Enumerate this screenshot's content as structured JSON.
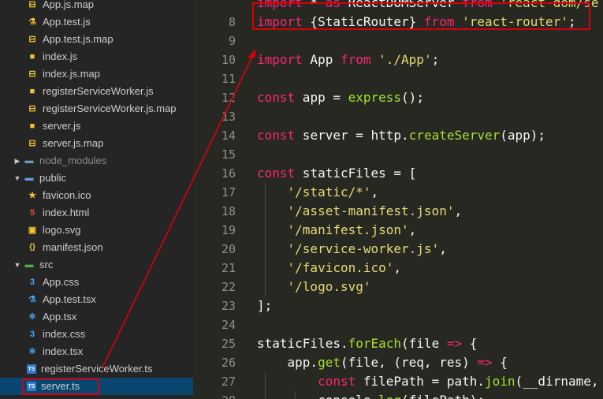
{
  "sidebar": {
    "items": [
      {
        "label": "App.js.map",
        "icon": "file-map-icon",
        "indent": 2,
        "kind": "file",
        "iconColor": "#f1c232",
        "iconGlyph": "⊟"
      },
      {
        "label": "App.test.js",
        "icon": "flask-icon",
        "indent": 2,
        "kind": "file",
        "iconColor": "#f1c232",
        "iconGlyph": "⚗"
      },
      {
        "label": "App.test.js.map",
        "icon": "file-map-icon",
        "indent": 2,
        "kind": "file",
        "iconColor": "#f1c232",
        "iconGlyph": "⊟"
      },
      {
        "label": "index.js",
        "icon": "js-file-icon",
        "indent": 2,
        "kind": "file",
        "iconColor": "#f1c232",
        "iconGlyph": "■"
      },
      {
        "label": "index.js.map",
        "icon": "file-map-icon",
        "indent": 2,
        "kind": "file",
        "iconColor": "#f1c232",
        "iconGlyph": "⊟"
      },
      {
        "label": "registerServiceWorker.js",
        "icon": "js-file-icon",
        "indent": 2,
        "kind": "file",
        "iconColor": "#f1c232",
        "iconGlyph": "■"
      },
      {
        "label": "registerServiceWorker.js.map",
        "icon": "file-map-icon",
        "indent": 2,
        "kind": "file",
        "iconColor": "#f1c232",
        "iconGlyph": "⊟"
      },
      {
        "label": "server.js",
        "icon": "js-file-icon",
        "indent": 2,
        "kind": "file",
        "iconColor": "#f1c232",
        "iconGlyph": "■"
      },
      {
        "label": "server.js.map",
        "icon": "file-map-icon",
        "indent": 2,
        "kind": "file",
        "iconColor": "#f1c232",
        "iconGlyph": "⊟"
      },
      {
        "label": "node_modules",
        "icon": "folder-icon",
        "indent": 1,
        "kind": "folder-collapsed",
        "iconColor": "#6a9fb5",
        "iconGlyph": "▬"
      },
      {
        "label": "public",
        "icon": "folder-open-icon",
        "indent": 1,
        "kind": "folder-open",
        "iconColor": "#5aa0e0",
        "iconGlyph": "▬"
      },
      {
        "label": "favicon.ico",
        "icon": "star-icon",
        "indent": 2,
        "kind": "file",
        "iconColor": "#f1c232",
        "iconGlyph": "★"
      },
      {
        "label": "index.html",
        "icon": "html-file-icon",
        "indent": 2,
        "kind": "file",
        "iconColor": "#e44d26",
        "iconGlyph": "5"
      },
      {
        "label": "logo.svg",
        "icon": "image-file-icon",
        "indent": 2,
        "kind": "file",
        "iconColor": "#f1c232",
        "iconGlyph": "▣"
      },
      {
        "label": "manifest.json",
        "icon": "json-file-icon",
        "indent": 2,
        "kind": "file",
        "iconColor": "#f1c232",
        "iconGlyph": "{}"
      },
      {
        "label": "src",
        "icon": "folder-open-icon",
        "indent": 1,
        "kind": "folder-open",
        "iconColor": "#4caf50",
        "iconGlyph": "▬"
      },
      {
        "label": "App.css",
        "icon": "css-file-icon",
        "indent": 2,
        "kind": "file",
        "iconColor": "#42a5f5",
        "iconGlyph": "3"
      },
      {
        "label": "App.test.tsx",
        "icon": "flask-icon",
        "indent": 2,
        "kind": "file",
        "iconColor": "#42a5f5",
        "iconGlyph": "⚗"
      },
      {
        "label": "App.tsx",
        "icon": "react-icon",
        "indent": 2,
        "kind": "file",
        "iconColor": "#42a5f5",
        "iconGlyph": "⚛"
      },
      {
        "label": "index.css",
        "icon": "css-file-icon",
        "indent": 2,
        "kind": "file",
        "iconColor": "#42a5f5",
        "iconGlyph": "3"
      },
      {
        "label": "index.tsx",
        "icon": "react-icon",
        "indent": 2,
        "kind": "file",
        "iconColor": "#42a5f5",
        "iconGlyph": "⚛"
      },
      {
        "label": "registerServiceWorker.ts",
        "icon": "typescript-file-icon",
        "indent": 2,
        "kind": "file",
        "iconColor": "#3178c6",
        "iconGlyph": "TS"
      },
      {
        "label": "server.ts",
        "icon": "typescript-file-icon",
        "indent": 2,
        "kind": "file",
        "iconColor": "#3178c6",
        "iconGlyph": "TS",
        "selected": true
      }
    ]
  },
  "editor": {
    "lines": [
      {
        "n": "",
        "tokens": [
          [
            "kw",
            "import"
          ],
          [
            "plain",
            " * "
          ],
          [
            "kw",
            "as"
          ],
          [
            "plain",
            " ReactDOMServer "
          ],
          [
            "kw",
            "from"
          ],
          [
            "plain",
            " "
          ],
          [
            "str",
            "'react-dom/se"
          ]
        ]
      },
      {
        "n": "8",
        "tokens": [
          [
            "kw",
            "import"
          ],
          [
            "plain",
            " {StaticRouter} "
          ],
          [
            "kw",
            "from"
          ],
          [
            "plain",
            " "
          ],
          [
            "str",
            "'react-router'"
          ],
          [
            "plain",
            ";"
          ]
        ]
      },
      {
        "n": "9",
        "tokens": []
      },
      {
        "n": "10",
        "tokens": [
          [
            "kw",
            "import"
          ],
          [
            "plain",
            " App "
          ],
          [
            "kw",
            "from"
          ],
          [
            "plain",
            " "
          ],
          [
            "str",
            "'./App'"
          ],
          [
            "plain",
            ";"
          ]
        ]
      },
      {
        "n": "11",
        "tokens": []
      },
      {
        "n": "12",
        "tokens": [
          [
            "kw",
            "const"
          ],
          [
            "plain",
            " app = "
          ],
          [
            "fn",
            "express"
          ],
          [
            "plain",
            "();"
          ]
        ]
      },
      {
        "n": "13",
        "tokens": []
      },
      {
        "n": "14",
        "tokens": [
          [
            "kw",
            "const"
          ],
          [
            "plain",
            " server = http."
          ],
          [
            "fn",
            "createServer"
          ],
          [
            "plain",
            "(app);"
          ]
        ]
      },
      {
        "n": "15",
        "tokens": []
      },
      {
        "n": "16",
        "tokens": [
          [
            "kw",
            "const"
          ],
          [
            "plain",
            " staticFiles = ["
          ]
        ]
      },
      {
        "n": "17",
        "tokens": [
          [
            "plain",
            "    "
          ],
          [
            "str",
            "'/static/*'"
          ],
          [
            "plain",
            ","
          ]
        ]
      },
      {
        "n": "18",
        "tokens": [
          [
            "plain",
            "    "
          ],
          [
            "str",
            "'/asset-manifest.json'"
          ],
          [
            "plain",
            ","
          ]
        ]
      },
      {
        "n": "19",
        "tokens": [
          [
            "plain",
            "    "
          ],
          [
            "str",
            "'/manifest.json'"
          ],
          [
            "plain",
            ","
          ]
        ]
      },
      {
        "n": "20",
        "tokens": [
          [
            "plain",
            "    "
          ],
          [
            "str",
            "'/service-worker.js'"
          ],
          [
            "plain",
            ","
          ]
        ]
      },
      {
        "n": "21",
        "tokens": [
          [
            "plain",
            "    "
          ],
          [
            "str",
            "'/favicon.ico'"
          ],
          [
            "plain",
            ","
          ]
        ]
      },
      {
        "n": "22",
        "tokens": [
          [
            "plain",
            "    "
          ],
          [
            "str",
            "'/logo.svg'"
          ]
        ]
      },
      {
        "n": "23",
        "tokens": [
          [
            "plain",
            "];"
          ]
        ]
      },
      {
        "n": "24",
        "tokens": []
      },
      {
        "n": "25",
        "tokens": [
          [
            "plain",
            "staticFiles."
          ],
          [
            "fn",
            "forEach"
          ],
          [
            "plain",
            "(file "
          ],
          [
            "kw",
            "=>"
          ],
          [
            "plain",
            " {"
          ]
        ]
      },
      {
        "n": "26",
        "tokens": [
          [
            "plain",
            "    app."
          ],
          [
            "fn",
            "get"
          ],
          [
            "plain",
            "(file, (req, res) "
          ],
          [
            "kw",
            "=>"
          ],
          [
            "plain",
            " {"
          ]
        ]
      },
      {
        "n": "27",
        "tokens": [
          [
            "plain",
            "        "
          ],
          [
            "kw",
            "const"
          ],
          [
            "plain",
            " filePath = path."
          ],
          [
            "fn",
            "join"
          ],
          [
            "plain",
            "(__dirname,"
          ]
        ]
      },
      {
        "n": "28",
        "tokens": [
          [
            "plain",
            "        console."
          ],
          [
            "fn",
            "log"
          ],
          [
            "plain",
            "(filePath);"
          ]
        ]
      }
    ]
  },
  "colors": {
    "annotation": "#d9000d",
    "selection": "#094771"
  }
}
